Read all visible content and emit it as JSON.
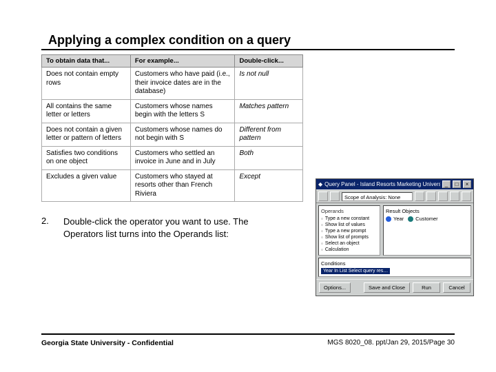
{
  "title": "Applying a complex condition on a query",
  "table": {
    "headers": [
      "To obtain data that...",
      "For example...",
      "Double-click..."
    ],
    "rows": [
      {
        "c1": "Does not contain empty rows",
        "c2": "Customers who have paid (i.e., their invoice dates are in the database)",
        "c3": "Is not null"
      },
      {
        "c1": "All contains the same letter or letters",
        "c2": "Customers whose names begin with the letters S",
        "c3": "Matches pattern"
      },
      {
        "c1": "Does not contain a given letter or pattern of letters",
        "c2": "Customers whose names do not begin with S",
        "c3": "Different from pattern"
      },
      {
        "c1": "Satisfies two conditions on one object",
        "c2": "Customers who settled an invoice in June and in July",
        "c3": "Both"
      },
      {
        "c1": "Excludes a given value",
        "c2": "Customers who stayed at resorts other than French Riviera",
        "c3": "Except"
      }
    ]
  },
  "step": {
    "num": "2.",
    "text": "Double-click the operator you want to use. The Operators list turns into the Operands list:"
  },
  "panel": {
    "window_title": "Query Panel - Island Resorts Marketing Universe",
    "tab_label": "Scope of Analysis: None",
    "operands_label": "Operands",
    "operands": [
      "Type a new constant",
      "Show list of values",
      "Type a new prompt",
      "Show list of prompts",
      "Select an object",
      "Calculation"
    ],
    "result_label": "Result Objects",
    "result_objects": [
      {
        "name": "Year",
        "color": "blue"
      },
      {
        "name": "Customer",
        "color": "teal"
      }
    ],
    "conditions_label": "Conditions",
    "conditions_sel": "Year In List   Select query res…",
    "buttons": {
      "options": "Options...",
      "save": "Save and Close",
      "run": "Run",
      "cancel": "Cancel"
    }
  },
  "footer": {
    "left": "Georgia State University - Confidential",
    "right": "MGS 8020_08. ppt/Jan 29, 2015/Page 30"
  }
}
